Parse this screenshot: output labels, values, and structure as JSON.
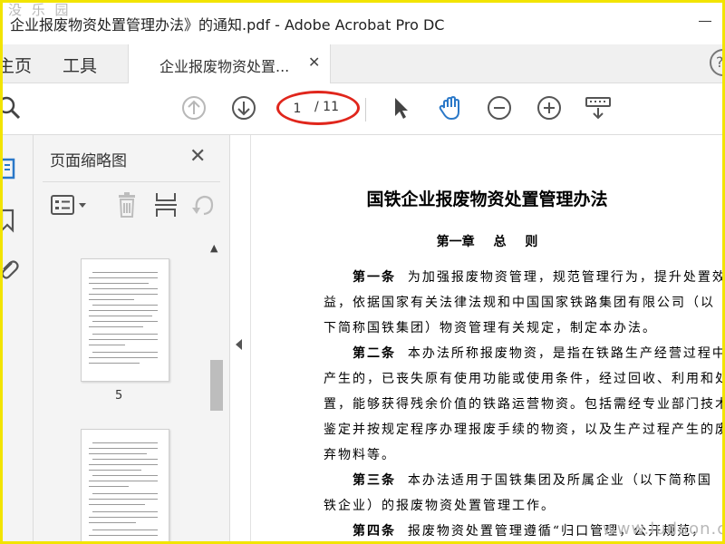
{
  "window": {
    "title": "企业报废物资处置管理办法》的通知.pdf - Adobe Acrobat Pro DC",
    "corner_watermark": "没 乐 园"
  },
  "tabs": {
    "home": "主页",
    "tools": "工具",
    "document": "企业报废物资处置...",
    "close_icon": "close-icon",
    "help_icon": "help-icon"
  },
  "toolbar": {
    "page_current": "1",
    "page_total": "/ 11",
    "icons": [
      "search-icon",
      "prev-page-icon",
      "next-page-icon",
      "select-tool-icon",
      "hand-tool-icon",
      "zoom-out-icon",
      "zoom-in-icon",
      "keyboard-icon"
    ],
    "highlight_color": "#e0261c"
  },
  "sidebar": {
    "panel_title": "页面缩略图",
    "thumbnails": [
      {
        "label": "5"
      },
      {
        "label": ""
      }
    ]
  },
  "document": {
    "title": "国铁企业报废物资处置管理办法",
    "chapter": "第一章 总 则",
    "paragraphs": [
      {
        "article": "第一条",
        "lines": [
          "为加强报废物资管理，规范管理行为，提升处置效",
          "益，依据国家有关法律法规和中国国家铁路集团有限公司（以",
          "下简称国铁集团）物资管理有关规定，制定本办法。"
        ]
      },
      {
        "article": "第二条",
        "lines": [
          "本办法所称报废物资，是指在铁路生产经营过程中",
          "产生的，已丧失原有使用功能或使用条件，经过回收、利用和处",
          "置，能够获得残余价值的铁路运营物资。包括需经专业部门技术",
          "鉴定并按规定程序办理报废手续的物资，以及生产过程产生的废",
          "弃物料等。"
        ]
      },
      {
        "article": "第三条",
        "lines": [
          "本办法适用于国铁集团及所属企业（以下简称国",
          "铁企业）的报废物资处置管理工作。"
        ]
      },
      {
        "article": "第四条",
        "lines": [
          "报废物资处置管理遵循“归口管理，公开规范，"
        ]
      }
    ]
  },
  "footer_watermark": "www.ludaon.com"
}
